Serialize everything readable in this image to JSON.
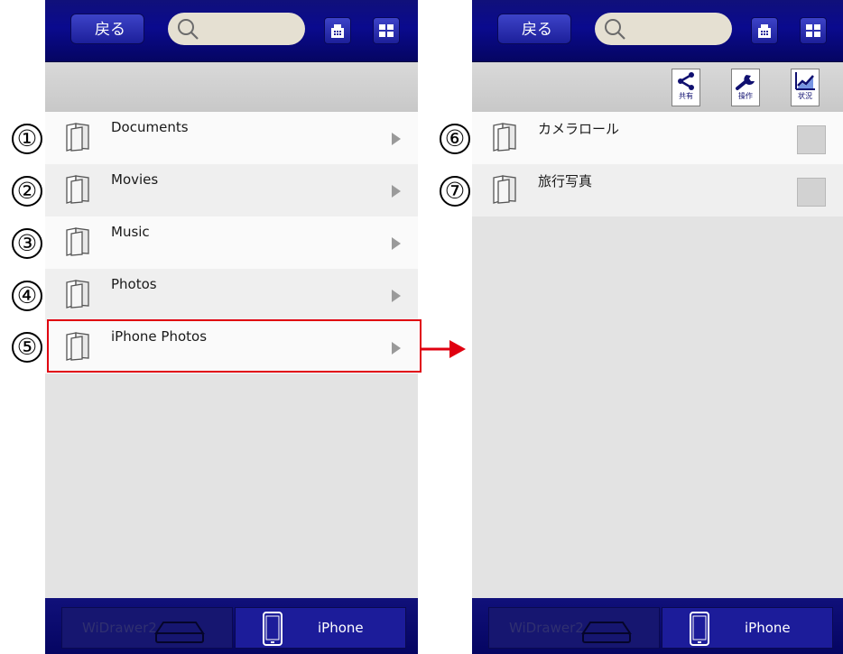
{
  "header": {
    "back_label": "戻る",
    "search_placeholder": ""
  },
  "left_screen": {
    "rows": [
      {
        "label": "Documents"
      },
      {
        "label": "Movies"
      },
      {
        "label": "Music"
      },
      {
        "label": "Photos"
      },
      {
        "label": "iPhone Photos"
      }
    ]
  },
  "right_screen": {
    "toolbar": {
      "share_label": "共有",
      "operation_label": "操作",
      "status_label": "状況"
    },
    "rows": [
      {
        "label": "カメラロール"
      },
      {
        "label": "旅行写真"
      }
    ]
  },
  "bottom_tabs": {
    "widrawer_label": "WiDrawer2",
    "iphone_label": "iPhone"
  },
  "callouts": [
    "①",
    "②",
    "③",
    "④",
    "⑤",
    "⑥",
    "⑦"
  ],
  "colors": {
    "header_blue": "#0a0a8e",
    "highlight_red": "#e00010",
    "search_bg": "#e5e0d2"
  },
  "icons": {
    "search": "search-icon",
    "home": "home-icon",
    "grid": "grid-icon",
    "folder": "folder-icon",
    "chevron": "chevron-right-icon",
    "share": "share-icon",
    "wrench": "wrench-icon",
    "chart": "chart-icon",
    "drive": "drive-icon",
    "phone": "phone-icon"
  }
}
